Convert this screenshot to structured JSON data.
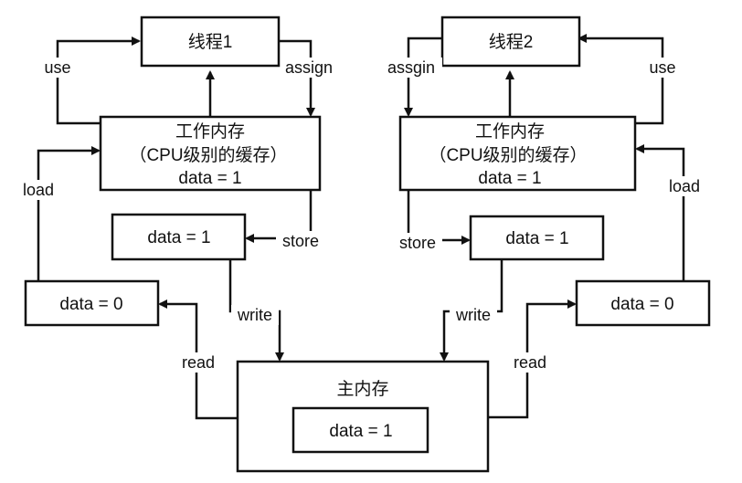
{
  "left": {
    "thread": "线程1",
    "work_mem_title": "工作内存",
    "work_mem_subtitle": "（CPU级别的缓存）",
    "work_mem_value": "data = 1",
    "store_buffer_value": "data = 1",
    "read_buffer_value": "data = 0",
    "labels": {
      "use": "use",
      "assign": "assign",
      "load": "load",
      "store": "store",
      "write": "write",
      "read": "read"
    }
  },
  "right": {
    "thread": "线程2",
    "work_mem_title": "工作内存",
    "work_mem_subtitle": "（CPU级别的缓存）",
    "work_mem_value": "data = 1",
    "store_buffer_value": "data = 1",
    "read_buffer_value": "data = 0",
    "labels": {
      "use": "use",
      "assign": "assgin",
      "load": "load",
      "store": "store",
      "write": "write",
      "read": "read"
    }
  },
  "main_memory": {
    "title": "主内存",
    "value": "data = 1"
  },
  "colors": {
    "stroke": "#111111",
    "background": "#ffffff"
  }
}
